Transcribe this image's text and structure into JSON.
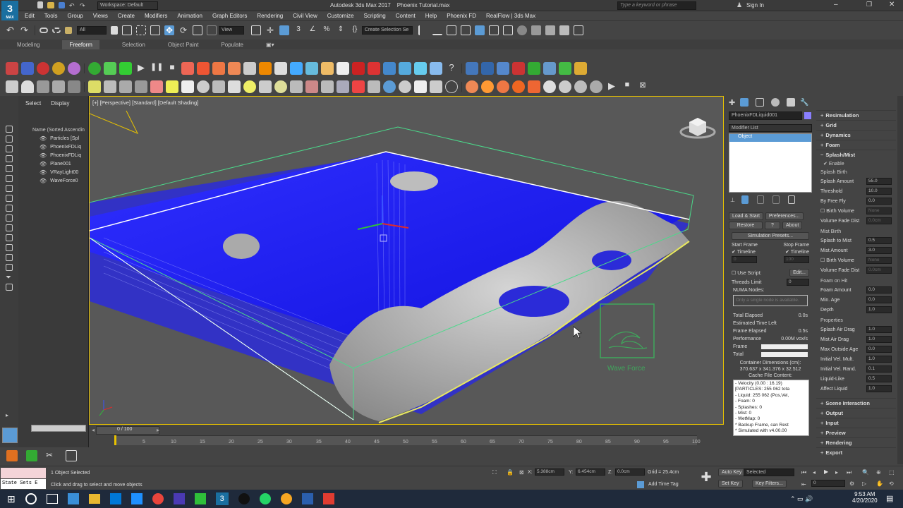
{
  "window": {
    "app_title": "Autodesk 3ds Max 2017",
    "file_name": "Phoenix Tutorial.max",
    "workspace": "Workspace: Default",
    "search_placeholder": "Type a keyword or phrase",
    "sign_in": "Sign In",
    "logo_main": "3",
    "logo_sub": "MAX"
  },
  "menu": [
    "Edit",
    "Tools",
    "Group",
    "Views",
    "Create",
    "Modifiers",
    "Animation",
    "Graph Editors",
    "Rendering",
    "Civil View",
    "Customize",
    "Scripting",
    "Content",
    "Help",
    "Phoenix FD",
    "RealFlow | 3ds Max"
  ],
  "main_toolbar": {
    "filter": "All",
    "view_dropdown": "View",
    "selection_set": "Create Selection Se"
  },
  "ribbon_tabs": [
    {
      "label": "Modeling",
      "active": false
    },
    {
      "label": "Freeform",
      "active": true
    },
    {
      "label": "Selection",
      "active": false
    },
    {
      "label": "Object Paint",
      "active": false
    },
    {
      "label": "Populate",
      "active": false
    }
  ],
  "explorer": {
    "tabs": [
      "Select",
      "Display"
    ],
    "header": "Name (Sorted Ascendin",
    "items": [
      "Particles [Spl",
      "PhoenixFDLiq",
      "PhoenixFDLiq",
      "Plane001",
      "VRayLight00",
      "WaveForce0"
    ]
  },
  "viewport": {
    "label": "[+] [Perspective] [Standard] [Default Shading]",
    "gizmo_label": "Wave Force"
  },
  "timeline": {
    "frame_display": "0 / 100",
    "ticks": [
      "5",
      "10",
      "15",
      "20",
      "25",
      "30",
      "35",
      "40",
      "45",
      "50",
      "55",
      "60",
      "65",
      "70",
      "75",
      "80",
      "85",
      "90",
      "95",
      "100"
    ]
  },
  "command_panel": {
    "object_name": "PhoenixFDLiquid001",
    "modifier_list": "Modifier List",
    "stack_item": "Object",
    "buttons": {
      "load_start": "Load & Start",
      "preferences": "Preferences...",
      "restore": "Restore",
      "help": "?",
      "about": "About",
      "presets": "Simulation Presets..."
    },
    "start_frame": "Start Frame",
    "stop_frame": "Stop Frame",
    "timeline_check": "Timeline",
    "start_value": "0",
    "stop_value": "100",
    "use_script": "Use Script:",
    "edit": "Edit...",
    "threads_limit": "Threads Limit",
    "threads_value": "0",
    "numa": "NUMA Nodes:",
    "numa_placeholder": "Only a single node is available.",
    "stats": [
      {
        "label": "Total Elapsed",
        "value": "0.0s"
      },
      {
        "label": "Estimated Time Left",
        "value": ""
      },
      {
        "label": "Frame Elapsed",
        "value": "0.5s"
      },
      {
        "label": "Performance",
        "value": "0.00M vox/s"
      }
    ],
    "frame_label": "Frame",
    "total_label": "Total",
    "container_title": "Container Dimensions (cm):",
    "container_value": "370.637 x 341.376 x 32.512",
    "cache_title": "Cache File Content:",
    "cache_lines": [
      "- Velocity (0.00 : 16.19)",
      "[PARTICLES: 255 062 tota",
      "- Liquid: 255 062 (Pos,Vel,",
      "- Foam: 0",
      "- Splashes: 0",
      "- Mist: 0",
      "- WetMap: 0",
      "* Backup Frame, can Rest",
      "* Simulated with v4.00.00"
    ]
  },
  "rollout": {
    "top_sections": [
      "Resimulation",
      "Grid",
      "Dynamics",
      "Foam"
    ],
    "splash_section": "Splash/Mist",
    "enable": "Enable",
    "splash_birth": "Splash Birth",
    "params1": [
      {
        "label": "Splash Amount",
        "value": "55.0"
      },
      {
        "label": "Threshold",
        "value": "10.0"
      },
      {
        "label": "By Free Fly",
        "value": "0.0"
      }
    ],
    "birth_volume": "Birth Volume",
    "birth_volume_value": "None",
    "volume_fade": "Volume Fade Dist",
    "volume_fade_value": "0.0cm",
    "mist_birth": "Mist Birth",
    "params2": [
      {
        "label": "Splash to Mist",
        "value": "0.5"
      },
      {
        "label": "Mist Amount",
        "value": "3.0"
      }
    ],
    "birth_volume2_value": "None",
    "volume_fade2_value": "0.0cm",
    "foam_on_hit": "Foam on Hit",
    "params3": [
      {
        "label": "Foam Amount",
        "value": "0.0"
      },
      {
        "label": "Min. Age",
        "value": "0.0"
      },
      {
        "label": "Depth",
        "value": "1.0"
      }
    ],
    "properties": "Properties",
    "params4": [
      {
        "label": "Splash Air Drag",
        "value": "1.0"
      },
      {
        "label": "Mist Air Drag",
        "value": "1.0"
      },
      {
        "label": "Max Outside Age",
        "value": "0.0"
      },
      {
        "label": "Initial Vel. Mult.",
        "value": "1.0"
      },
      {
        "label": "Initial Vel. Rand.",
        "value": "0.1"
      },
      {
        "label": "Liquid-Like",
        "value": "0.5"
      },
      {
        "label": "Affect Liquid",
        "value": "1.0"
      }
    ],
    "bottom_sections": [
      "Scene Interaction",
      "Output",
      "Input",
      "Preview",
      "Rendering",
      "Export"
    ]
  },
  "status": {
    "state_sets": "State Sets E",
    "selected": "1 Object Selected",
    "prompt": "Click and drag to select and move objects",
    "x_label": "X:",
    "x": "5.388cm",
    "y_label": "Y:",
    "y": "6.454cm",
    "z_label": "Z:",
    "z": "0.0cm",
    "grid": "Grid = 25.4cm",
    "add_time_tag": "Add Time Tag",
    "auto_key": "Auto Key",
    "selected_dd": "Selected",
    "set_key": "Set Key",
    "key_filters": "Key Filters...",
    "frame_value": "0"
  },
  "taskbar": {
    "time": "9:53 AM",
    "date": "4/20/2020"
  },
  "colors": {
    "water": "#1a1aff",
    "terrain": "#b8b8b8",
    "container": "#4bd98a",
    "selection": "#e8c200",
    "accent": "#5b9bd5"
  }
}
